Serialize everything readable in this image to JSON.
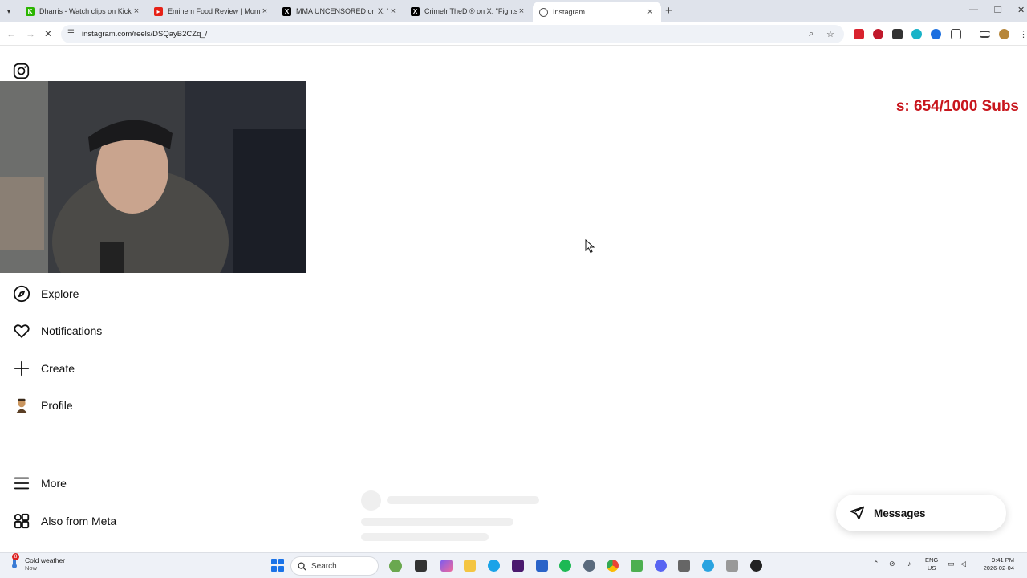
{
  "browser": {
    "tabs": [
      {
        "title": "Dharris - Watch clips on Kick",
        "favicon": "kick-icon",
        "color": "#2bb500"
      },
      {
        "title": "Eminem Food Review | Mom's S",
        "favicon": "youtube-icon",
        "color": "#e62117"
      },
      {
        "title": "MMA UNCENSORED on X: \"Sha",
        "favicon": "x-icon",
        "color": "#000000"
      },
      {
        "title": "CrimeInTheD ® on X: \"Fights o",
        "favicon": "x-icon",
        "color": "#000000"
      },
      {
        "title": "Instagram",
        "favicon": "instagram-icon",
        "color": "#555555",
        "active": true
      }
    ],
    "url": "instagram.com/reels/DSQayB2CZq_/"
  },
  "page": {
    "overlay_counter": "s: 654/1000  Subs",
    "sidebar": [
      {
        "label": "Explore",
        "icon": "compass-icon"
      },
      {
        "label": "Notifications",
        "icon": "heart-icon"
      },
      {
        "label": "Create",
        "icon": "plus-icon"
      },
      {
        "label": "Profile",
        "icon": "avatar-icon"
      },
      {
        "label": "More",
        "icon": "menu-icon"
      },
      {
        "label": "Also from Meta",
        "icon": "meta-apps-icon"
      }
    ],
    "messages_label": "Messages"
  },
  "taskbar": {
    "weather_title": "Cold weather",
    "weather_sub": "Now",
    "weather_badge": "8",
    "search_placeholder": "Search",
    "lang_line1": "ENG",
    "lang_line2": "US",
    "time": "9:41 PM",
    "date": "2026-02-04"
  },
  "colors": {
    "accent_red": "#c8161d",
    "taskbar_bg": "#eef1f7",
    "tabstrip_bg": "#dfe3eb"
  }
}
